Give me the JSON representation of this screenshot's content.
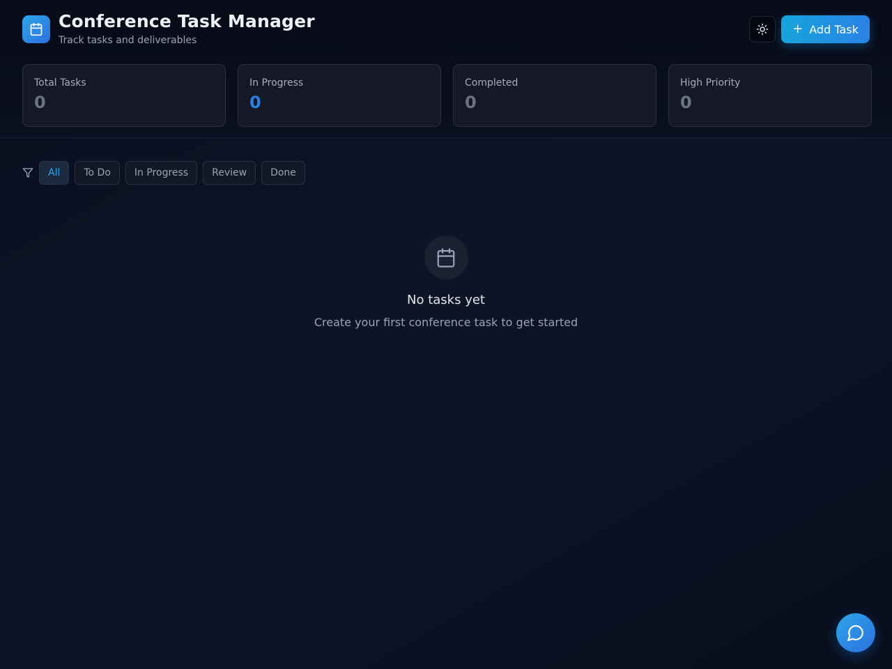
{
  "app": {
    "title": "Conference Task Manager",
    "subtitle": "Track tasks and deliverables",
    "logo_icon": "calendar-icon"
  },
  "header": {
    "theme_toggle_icon": "sun-icon",
    "add_task_label": "Add Task",
    "add_task_icon": "plus-icon"
  },
  "stats": [
    {
      "label": "Total Tasks",
      "value": "0",
      "color": "#6b7280"
    },
    {
      "label": "In Progress",
      "value": "0",
      "color": "#2b7fe6"
    },
    {
      "label": "Completed",
      "value": "0",
      "color": "#6b7280"
    },
    {
      "label": "High Priority",
      "value": "0",
      "color": "#6b7280"
    }
  ],
  "filters": {
    "icon": "filter-icon",
    "active": "All",
    "options": [
      "All",
      "To Do",
      "In Progress",
      "Review",
      "Done"
    ]
  },
  "empty_state": {
    "icon": "calendar-icon",
    "title": "No tasks yet",
    "message": "Create your first conference task to get started"
  },
  "chat": {
    "icon": "chat-bubble-icon"
  },
  "colors": {
    "accent": "#2ea7e8",
    "accent_dark": "#2b6fe0",
    "background": "#0b1020"
  }
}
